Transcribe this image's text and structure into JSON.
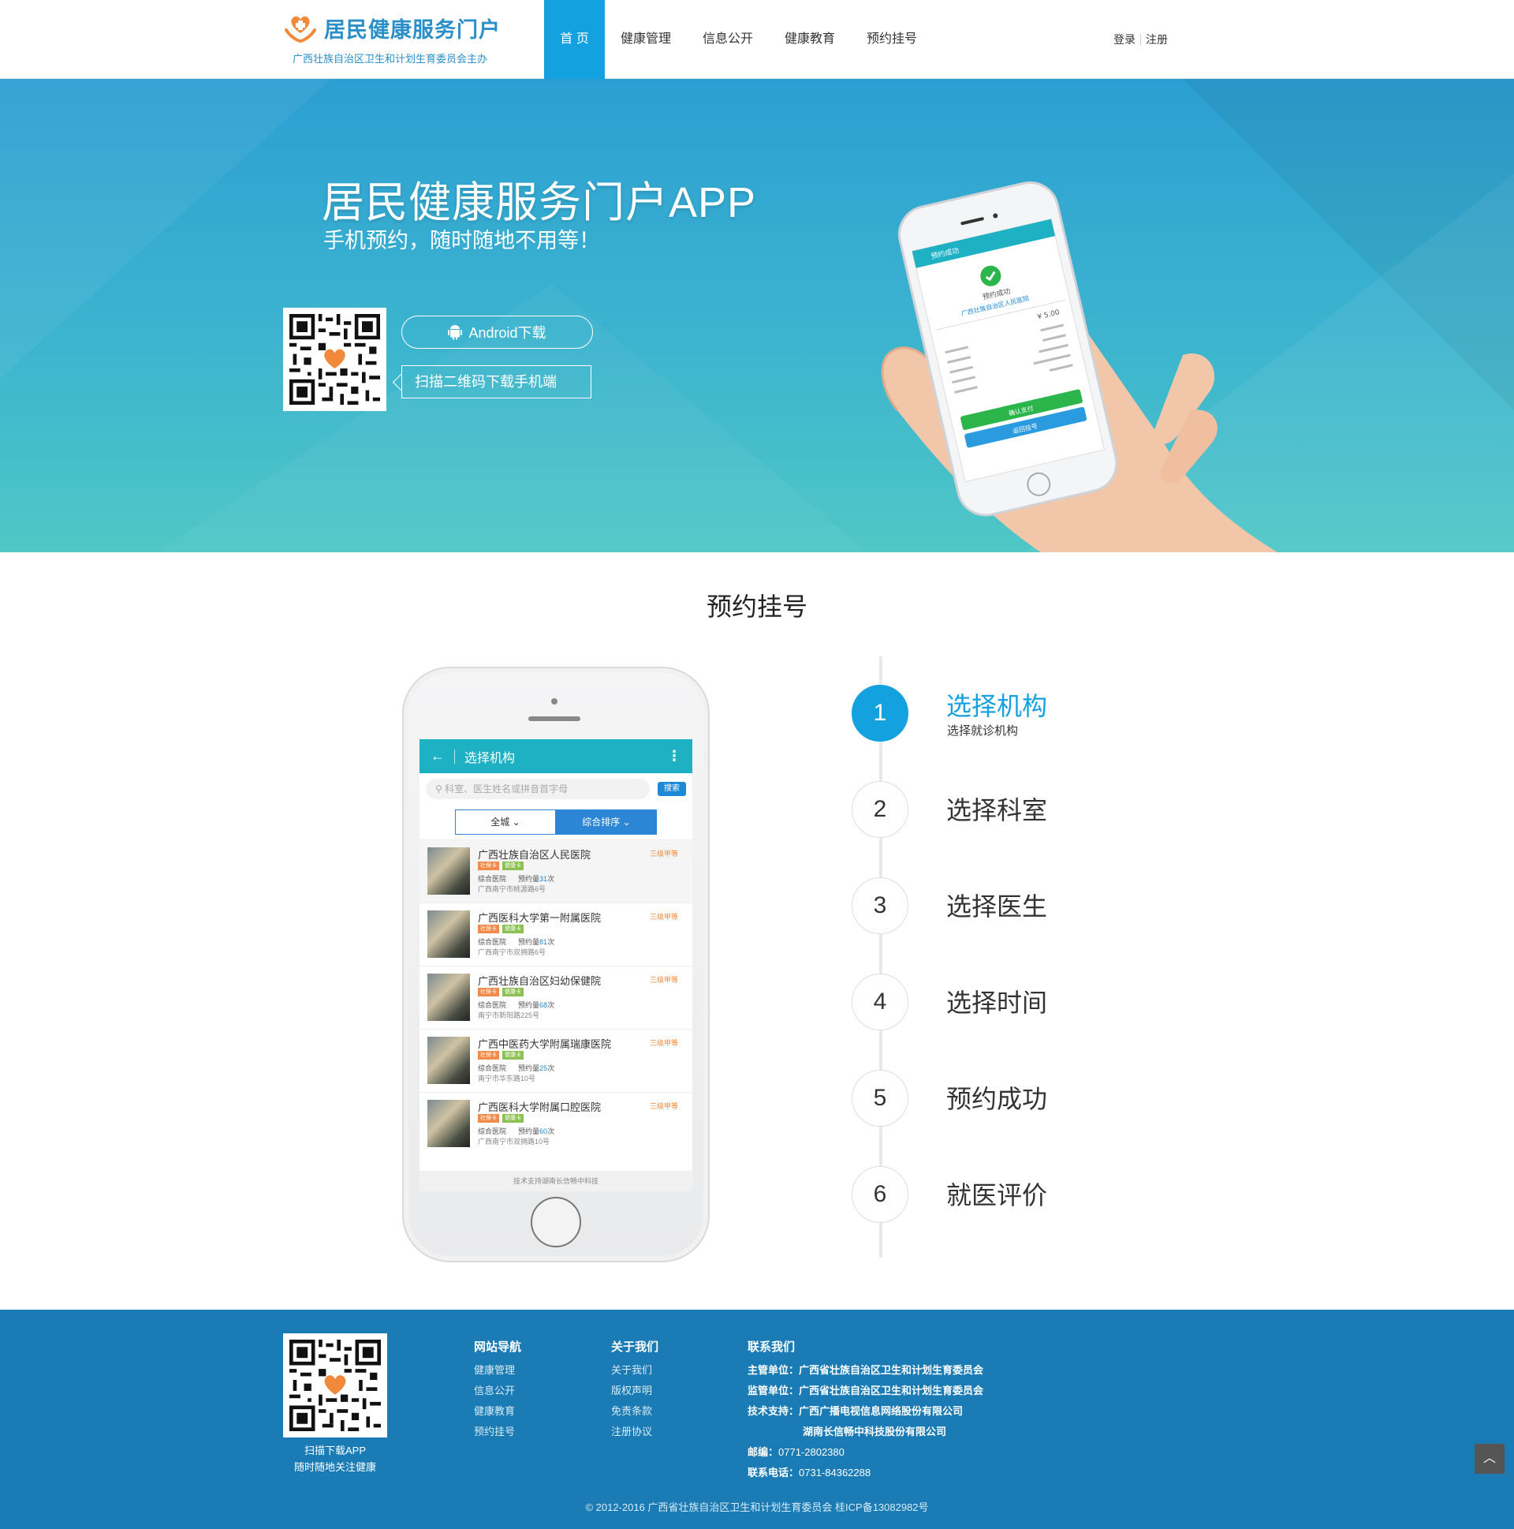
{
  "header": {
    "logo_title": "居民健康服务门户",
    "logo_sub": "广西壮族自治区卫生和计划生育委员会主办",
    "nav": [
      {
        "label": "首 页",
        "active": true
      },
      {
        "label": "健康管理"
      },
      {
        "label": "信息公开"
      },
      {
        "label": "健康教育"
      },
      {
        "label": "预约挂号"
      }
    ],
    "login": "登录",
    "register": "注册"
  },
  "hero": {
    "title": "居民健康服务门户APP",
    "subtitle": "手机预约，随时随地不用等！",
    "android_button": "Android下载",
    "scan_tip": "扫描二维码下载手机端",
    "phone_screen": {
      "bar_title": "预约成功",
      "status": "预约成功",
      "hospital": "广西壮族自治区人民医院",
      "amount": "¥ 5.00",
      "button_pay": "确认支付",
      "button_back": "返回挂号"
    }
  },
  "section": {
    "title": "预约挂号"
  },
  "app_screen": {
    "bar_title": "选择机构",
    "search_placeholder": "科室、医生姓名或拼音首字母",
    "search_button": "搜索",
    "filter_city": "全城",
    "filter_sort": "综合排序",
    "hospitals": [
      {
        "name": "广西壮族自治区人民医院",
        "grade": "三级甲等",
        "tag1": "社保卡",
        "tag2": "健康卡",
        "type": "综合医院",
        "count_prefix": "预约量",
        "count": "31",
        "count_suffix": "次",
        "addr": "广西南宁市桃源路6号"
      },
      {
        "name": "广西医科大学第一附属医院",
        "grade": "三级甲等",
        "tag1": "社保卡",
        "tag2": "健康卡",
        "type": "综合医院",
        "count_prefix": "预约量",
        "count": "81",
        "count_suffix": "次",
        "addr": "广西南宁市双拥路6号"
      },
      {
        "name": "广西壮族自治区妇幼保健院",
        "grade": "三级甲等",
        "tag1": "社保卡",
        "tag2": "健康卡",
        "type": "综合医院",
        "count_prefix": "预约量",
        "count": "68",
        "count_suffix": "次",
        "addr": "南宁市新阳路225号"
      },
      {
        "name": "广西中医药大学附属瑞康医院",
        "grade": "三级甲等",
        "tag1": "社保卡",
        "tag2": "健康卡",
        "type": "综合医院",
        "count_prefix": "预约量",
        "count": "25",
        "count_suffix": "次",
        "addr": "南宁市华东路10号"
      },
      {
        "name": "广西医科大学附属口腔医院",
        "grade": "三级甲等",
        "tag1": "社保卡",
        "tag2": "健康卡",
        "type": "综合医院",
        "count_prefix": "预约量",
        "count": "60",
        "count_suffix": "次",
        "addr": "广西南宁市双拥路10号"
      }
    ],
    "footer": "技术支持湖南长信畅中科技"
  },
  "steps": [
    {
      "num": "1",
      "label": "选择机构",
      "desc": "选择就诊机构",
      "active": true
    },
    {
      "num": "2",
      "label": "选择科室"
    },
    {
      "num": "3",
      "label": "选择医生"
    },
    {
      "num": "4",
      "label": "选择时间"
    },
    {
      "num": "5",
      "label": "预约成功"
    },
    {
      "num": "6",
      "label": "就医评价"
    }
  ],
  "footer": {
    "qr_text_1": "扫描下载APP",
    "qr_text_2": "随时随地关注健康",
    "nav_title": "网站导航",
    "nav_items": [
      "健康管理",
      "信息公开",
      "健康教育",
      "预约挂号"
    ],
    "about_title": "关于我们",
    "about_items": [
      "关于我们",
      "版权声明",
      "免责条款",
      "注册协议"
    ],
    "contact_title": "联系我们",
    "contact": {
      "supervisor_label": "主管单位：",
      "supervisor": "广西省壮族自治区卫生和计划生育委员会",
      "monitor_label": "监管单位：",
      "monitor": "广西省壮族自治区卫生和计划生育委员会",
      "tech_label": "技术支持：",
      "tech": "广西广播电视信息网络股份有限公司",
      "tech2": "湖南长信畅中科技股份有限公司",
      "zip_label": "邮编：",
      "zip": "0771-2802380",
      "phone_label": "联系电话：",
      "phone": "0731-84362288"
    },
    "copyright": "© 2012-2016 广西省壮族自治区卫生和计划生育委员会 桂ICP备13082982号"
  },
  "colors": {
    "accent": "#14a1e0",
    "footer_bg": "#1a7bb5",
    "hero_top": "#2c9fd2",
    "hero_bottom": "#4fc7c6"
  }
}
